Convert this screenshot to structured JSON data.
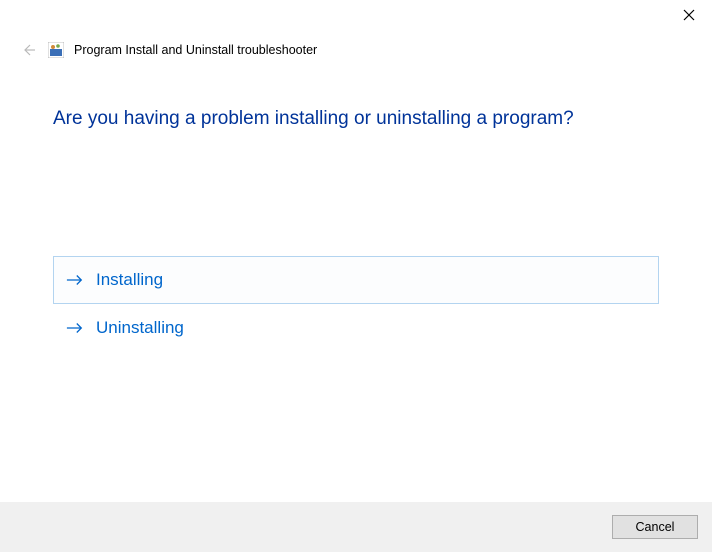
{
  "window": {
    "title": "Program Install and Uninstall troubleshooter"
  },
  "main": {
    "heading": "Are you having a problem installing or uninstalling a program?",
    "options": [
      {
        "label": "Installing",
        "selected": true
      },
      {
        "label": "Uninstalling",
        "selected": false
      }
    ]
  },
  "footer": {
    "cancel_label": "Cancel"
  }
}
